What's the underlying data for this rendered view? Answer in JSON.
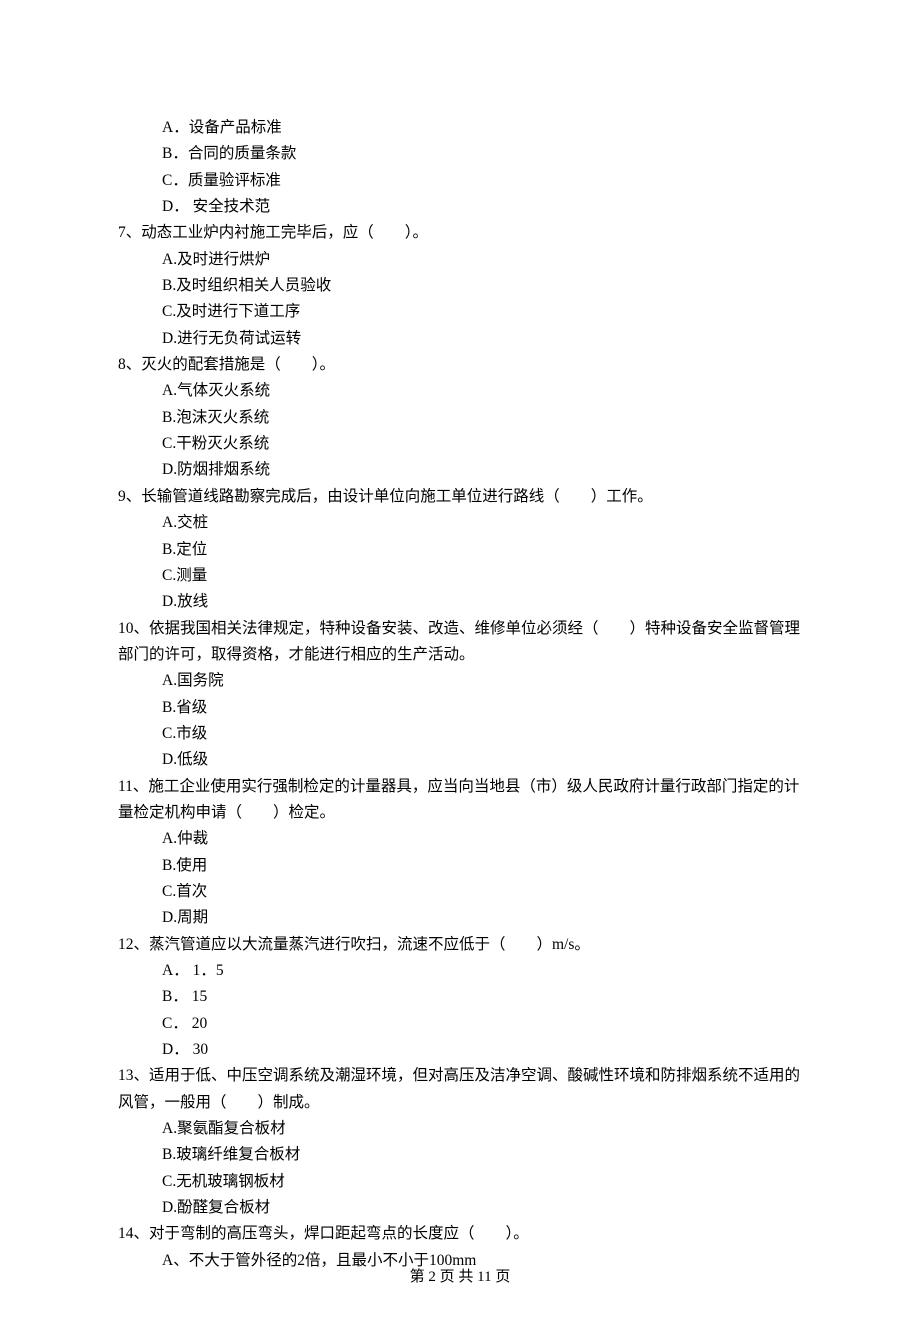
{
  "q6": {
    "optA": "A．设备产品标准",
    "optB": "B．合同的质量条款",
    "optC": "C．质量验评标准",
    "optD": "D． 安全技术范"
  },
  "q7": {
    "stem": "7、动态工业炉内衬施工完毕后，应（　　）。",
    "optA": "A.及时进行烘炉",
    "optB": "B.及时组织相关人员验收",
    "optC": "C.及时进行下道工序",
    "optD": "D.进行无负荷试运转"
  },
  "q8": {
    "stem": "8、灭火的配套措施是（　　）。",
    "optA": "A.气体灭火系统",
    "optB": "B.泡沫灭火系统",
    "optC": "C.干粉灭火系统",
    "optD": "D.防烟排烟系统"
  },
  "q9": {
    "stem": "9、长输管道线路勘察完成后，由设计单位向施工单位进行路线（　　）工作。",
    "optA": "A.交桩",
    "optB": "B.定位",
    "optC": "C.测量",
    "optD": "D.放线"
  },
  "q10": {
    "stem": "10、依据我国相关法律规定，特种设备安装、改造、维修单位必须经（　　）特种设备安全监督管理部门的许可，取得资格，才能进行相应的生产活动。",
    "optA": "A.国务院",
    "optB": "B.省级",
    "optC": "C.市级",
    "optD": "D.低级"
  },
  "q11": {
    "stem": "11、施工企业使用实行强制检定的计量器具，应当向当地县（市）级人民政府计量行政部门指定的计量检定机构申请（　　）检定。",
    "optA": "A.仲裁",
    "optB": "B.使用",
    "optC": "C.首次",
    "optD": "D.周期"
  },
  "q12": {
    "stem": "12、蒸汽管道应以大流量蒸汽进行吹扫，流速不应低于（　　）m/s。",
    "optA": "A． 1．5",
    "optB": "B． 15",
    "optC": "C． 20",
    "optD": "D． 30"
  },
  "q13": {
    "stem": "13、适用于低、中压空调系统及潮湿环境，但对高压及洁净空调、酸碱性环境和防排烟系统不适用的风管，一般用（　　）制成。",
    "optA": "A.聚氨酯复合板材",
    "optB": "B.玻璃纤维复合板材",
    "optC": "C.无机玻璃钢板材",
    "optD": "D.酚醛复合板材"
  },
  "q14": {
    "stem": "14、对于弯制的高压弯头，焊口距起弯点的长度应（　　）。",
    "optA": "A、不大于管外径的2倍，且最小不小于100mm"
  },
  "footer": "第 2 页 共 11 页"
}
